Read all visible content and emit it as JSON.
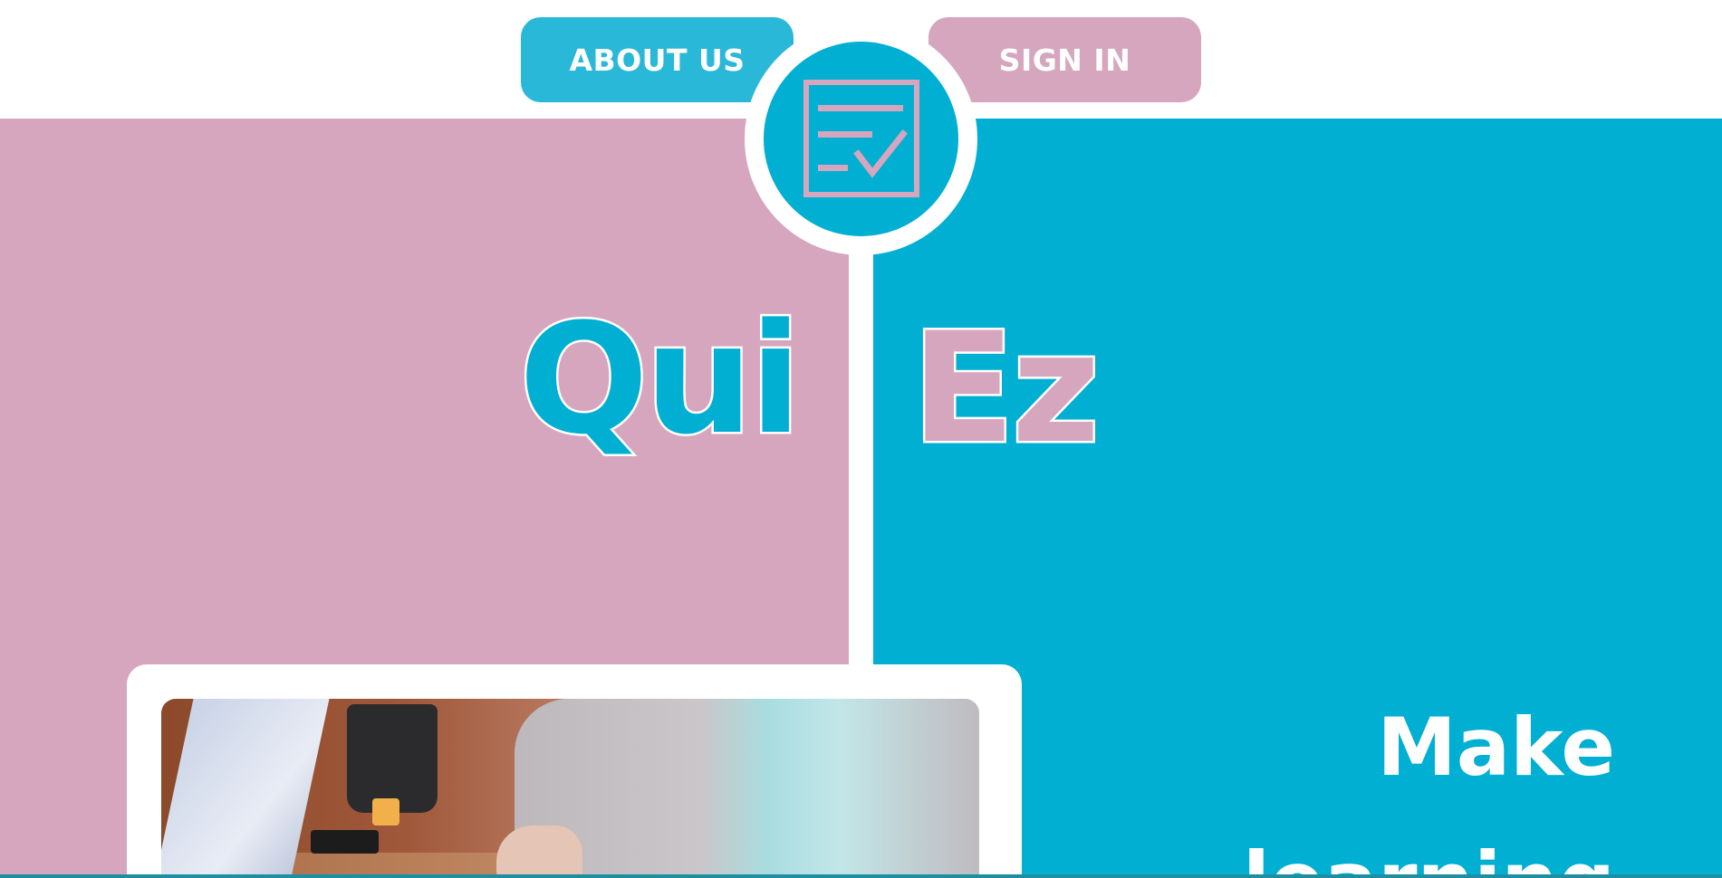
{
  "nav": {
    "about_label": "ABOUT US",
    "signin_label": "SIGN IN"
  },
  "logo": {
    "icon": "checklist-icon"
  },
  "hero": {
    "title_left": "Qui",
    "title_right": "Ez",
    "tagline_line1": "Make",
    "tagline_line2": "learning"
  },
  "photo": {
    "description_icon": "student-laptop-photo"
  },
  "colors": {
    "pink": "#d5a6bd",
    "teal": "#00afd2",
    "teal_button": "#2ab8d8",
    "white": "#ffffff"
  }
}
